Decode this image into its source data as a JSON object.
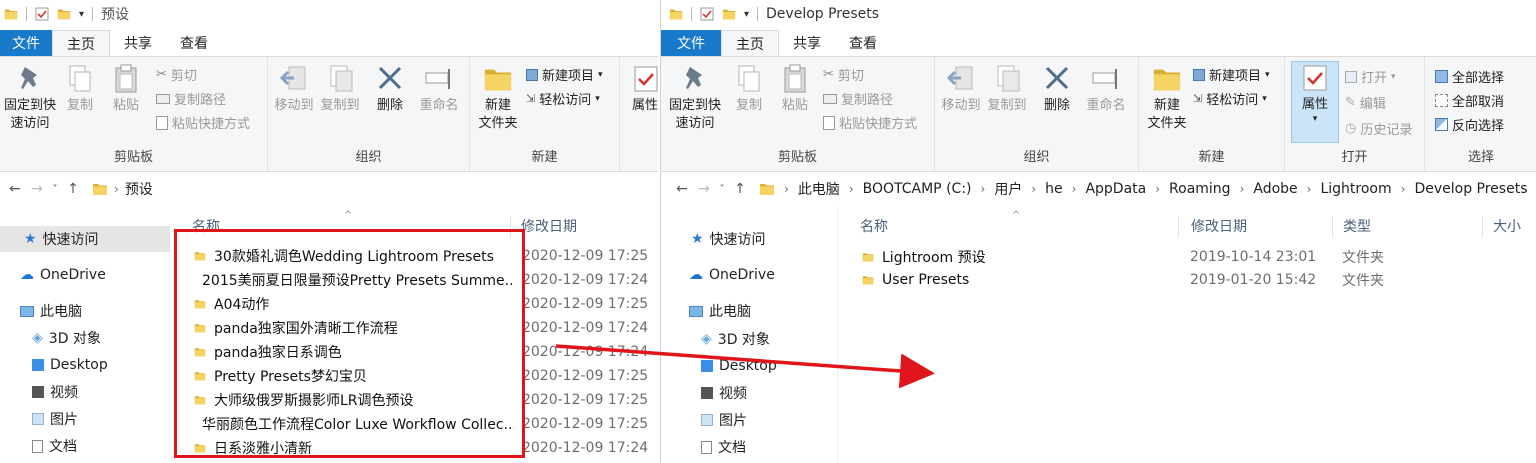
{
  "left_window": {
    "title": "预设",
    "tabs": {
      "file": "文件",
      "home": "主页",
      "share": "共享",
      "view": "查看"
    },
    "ribbon": {
      "pin_label_1": "固定到快",
      "pin_label_2": "速访问",
      "copy": "复制",
      "paste": "粘贴",
      "cut": "剪切",
      "copy_path": "复制路径",
      "paste_shortcut": "粘贴快捷方式",
      "clipboard_group": "剪贴板",
      "move_to": "移动到",
      "copy_to": "复制到",
      "delete": "删除",
      "rename": "重命名",
      "organize_group": "组织",
      "new_folder_1": "新建",
      "new_folder_2": "文件夹",
      "new_item": "新建项目",
      "easy_access": "轻松访问",
      "new_group": "新建",
      "properties": "属性"
    },
    "address": {
      "crumbs": [
        "预设"
      ]
    },
    "nav": {
      "quick_access": "快速访问",
      "onedrive": "OneDrive",
      "this_pc": "此电脑",
      "objects3d": "3D 对象",
      "desktop": "Desktop",
      "videos": "视频",
      "pictures": "图片",
      "documents": "文档"
    },
    "columns": {
      "name": "名称",
      "date": "修改日期"
    },
    "files": [
      {
        "name": "30款婚礼调色Wedding Lightroom Presets",
        "date": "2020-12-09 17:25"
      },
      {
        "name": "2015美丽夏日限量预设Pretty Presets Summe...",
        "date": "2020-12-09 17:24"
      },
      {
        "name": "A04动作",
        "date": "2020-12-09 17:25"
      },
      {
        "name": "panda独家国外清晰工作流程",
        "date": "2020-12-09 17:24"
      },
      {
        "name": "panda独家日系调色",
        "date": "2020-12-09 17:24"
      },
      {
        "name": "Pretty Presets梦幻宝贝",
        "date": "2020-12-09 17:25"
      },
      {
        "name": "大师级俄罗斯摄影师LR调色预设",
        "date": "2020-12-09 17:25"
      },
      {
        "name": "华丽颜色工作流程Color Luxe Workflow Collec...",
        "date": "2020-12-09 17:25"
      },
      {
        "name": "日系淡雅小清新",
        "date": "2020-12-09 17:24"
      }
    ]
  },
  "right_window": {
    "title": "Develop Presets",
    "tabs": {
      "file": "文件",
      "home": "主页",
      "share": "共享",
      "view": "查看"
    },
    "ribbon": {
      "pin_label_1": "固定到快",
      "pin_label_2": "速访问",
      "copy": "复制",
      "paste": "粘贴",
      "cut": "剪切",
      "copy_path": "复制路径",
      "paste_shortcut": "粘贴快捷方式",
      "clipboard_group": "剪贴板",
      "move_to": "移动到",
      "copy_to": "复制到",
      "delete": "删除",
      "rename": "重命名",
      "organize_group": "组织",
      "new_folder_1": "新建",
      "new_folder_2": "文件夹",
      "new_item": "新建项目",
      "easy_access": "轻松访问",
      "new_group": "新建",
      "properties": "属性",
      "open": "打开",
      "edit": "编辑",
      "history": "历史记录",
      "open_group": "打开",
      "select_all": "全部选择",
      "select_none": "全部取消",
      "invert": "反向选择",
      "select_group": "选择"
    },
    "address": {
      "crumbs": [
        "此电脑",
        "BOOTCAMP (C:)",
        "用户",
        "he",
        "AppData",
        "Roaming",
        "Adobe",
        "Lightroom",
        "Develop Presets"
      ]
    },
    "nav": {
      "quick_access": "快速访问",
      "onedrive": "OneDrive",
      "this_pc": "此电脑",
      "objects3d": "3D 对象",
      "desktop": "Desktop",
      "videos": "视频",
      "pictures": "图片",
      "documents": "文档"
    },
    "columns": {
      "name": "名称",
      "date": "修改日期",
      "type": "类型",
      "size": "大小"
    },
    "files": [
      {
        "name": "Lightroom 预设",
        "date": "2019-10-14 23:01",
        "type": "文件夹"
      },
      {
        "name": "User Presets",
        "date": "2019-01-20 15:42",
        "type": "文件夹"
      }
    ]
  },
  "colors": {
    "accent": "#1979ca",
    "highlight_red": "#e0141b",
    "folder": "#f1c84b"
  }
}
